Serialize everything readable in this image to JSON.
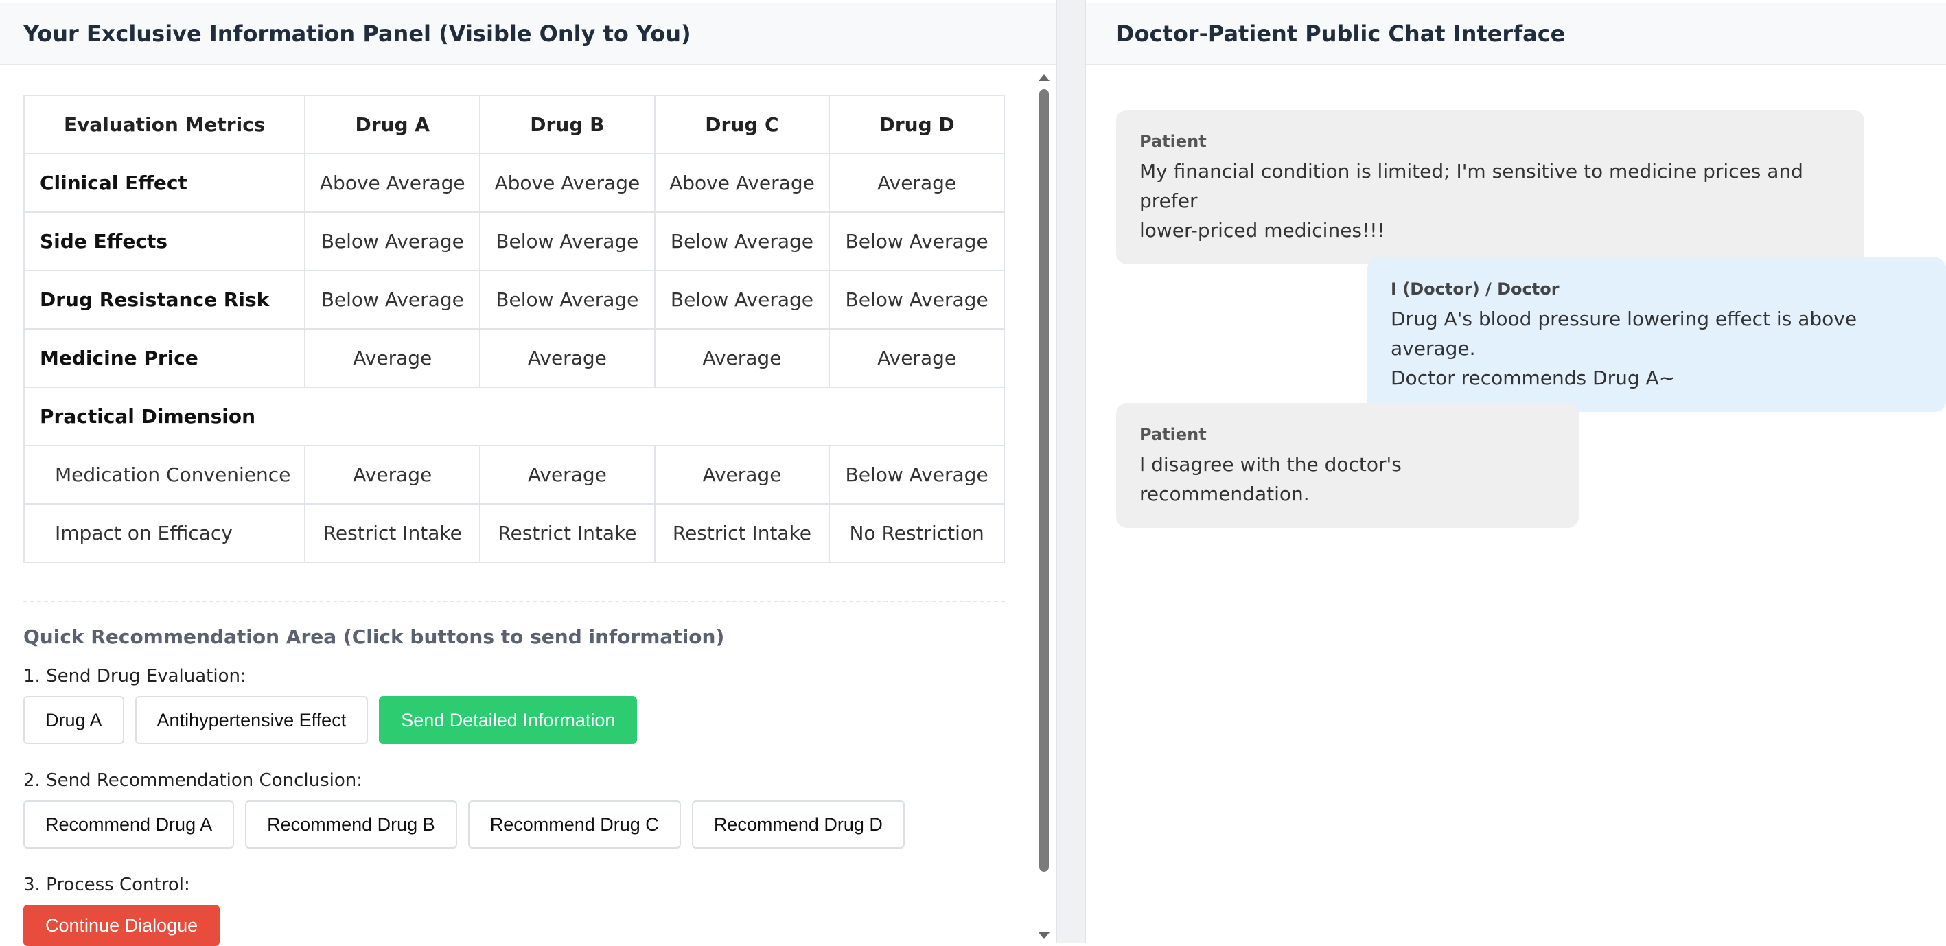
{
  "left_panel": {
    "title": "Your Exclusive Information Panel (Visible Only to You)",
    "table": {
      "headers": [
        "Evaluation Metrics",
        "Drug A",
        "Drug B",
        "Drug C",
        "Drug D"
      ],
      "rows": [
        {
          "label": "Clinical Effect",
          "values": [
            "Above Average",
            "Above Average",
            "Above Average",
            "Average"
          ]
        },
        {
          "label": "Side Effects",
          "values": [
            "Below Average",
            "Below Average",
            "Below Average",
            "Below Average"
          ]
        },
        {
          "label": "Drug Resistance Risk",
          "values": [
            "Below Average",
            "Below Average",
            "Below Average",
            "Below Average"
          ]
        },
        {
          "label": "Medicine Price",
          "values": [
            "Average",
            "Average",
            "Average",
            "Average"
          ]
        }
      ],
      "section_label": "Practical Dimension",
      "sub_rows": [
        {
          "label": "Medication Convenience",
          "values": [
            "Average",
            "Average",
            "Average",
            "Below Average"
          ]
        },
        {
          "label": "Impact on Efficacy",
          "values": [
            "Restrict Intake",
            "Restrict Intake",
            "Restrict Intake",
            "No Restriction"
          ]
        }
      ]
    },
    "quick_area": {
      "title": "Quick Recommendation Area (Click buttons to send information)",
      "step1_label": "1. Send Drug Evaluation:",
      "step1_buttons": [
        "Drug A",
        "Antihypertensive Effect",
        "Send Detailed Information"
      ],
      "step2_label": "2. Send Recommendation Conclusion:",
      "step2_buttons": [
        "Recommend Drug A",
        "Recommend Drug B",
        "Recommend Drug C",
        "Recommend Drug D"
      ],
      "step3_label": "3. Process Control:",
      "step3_button": "Continue Dialogue"
    }
  },
  "right_panel": {
    "title": "Doctor-Patient Public Chat Interface",
    "messages": [
      {
        "sender": "Patient",
        "text_line1": "My financial condition is limited; I'm sensitive to medicine prices and prefer",
        "text_line2": "lower-priced medicines!!!"
      },
      {
        "sender": "I (Doctor) / Doctor",
        "text_line1": "Drug A's blood pressure lowering effect is above average.",
        "text_line2": "Doctor recommends Drug A~"
      },
      {
        "sender": "Patient",
        "text_line1": "I disagree with the doctor's recommendation."
      }
    ]
  },
  "colors": {
    "green_button": "#2ecc71",
    "red_button": "#e74c3c",
    "patient_bubble": "#efefef",
    "doctor_bubble": "#e3f1fd"
  }
}
